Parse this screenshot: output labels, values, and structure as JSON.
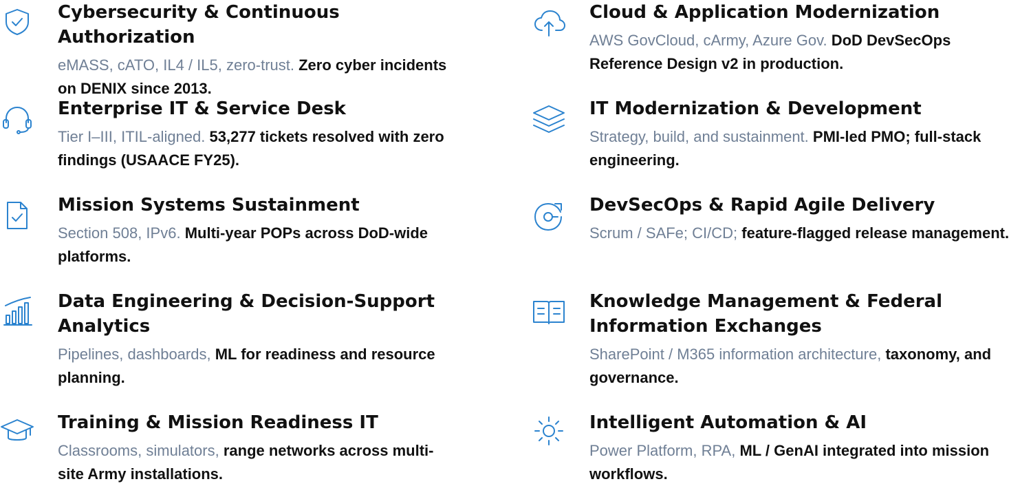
{
  "capabilities": {
    "left": [
      {
        "icon": "shield-check-icon",
        "title": "Cybersecurity & Continuous Authorization",
        "lead": "eMASS, cATO, IL4 / IL5, zero-trust.",
        "detail": "Zero cyber incidents on DENIX since 2013."
      },
      {
        "icon": "headset-icon",
        "title": "Enterprise IT & Service Desk",
        "lead": "Tier I–III, ITIL-aligned.",
        "detail": "53,277 tickets resolved with zero findings (USAACE FY25)."
      },
      {
        "icon": "document-check-icon",
        "title": "Mission Systems Sustainment",
        "lead": "Section 508, IPv6.",
        "detail": "Multi-year POPs across DoD-wide platforms."
      },
      {
        "icon": "bar-chart-icon",
        "title": "Data Engineering & Decision-Support Analytics",
        "lead": "Pipelines, dashboards,",
        "detail": "ML for readiness and resource planning."
      },
      {
        "icon": "graduation-cap-icon",
        "title": "Training & Mission Readiness IT",
        "lead": "Classrooms, simulators,",
        "detail": "range networks across multi-site Army installations."
      }
    ],
    "right": [
      {
        "icon": "cloud-upload-icon",
        "title": "Cloud & Application Modernization",
        "lead": "AWS GovCloud, cArmy, Azure Gov.",
        "detail": "DoD DevSecOps Reference Design v2 in production."
      },
      {
        "icon": "layers-icon",
        "title": "IT Modernization & Development",
        "lead": "Strategy, build, and sustainment.",
        "detail": "PMI-led PMO; full-stack engineering."
      },
      {
        "icon": "refresh-cycle-icon",
        "title": "DevSecOps & Rapid Agile Delivery",
        "lead": "Scrum / SAFe; CI/CD;",
        "detail": "feature-flagged release management."
      },
      {
        "icon": "open-book-icon",
        "title": "Knowledge Management & Federal Information Exchanges",
        "lead": "SharePoint / M365 information architecture,",
        "detail": "taxonomy, and governance."
      },
      {
        "icon": "sun-spark-icon",
        "title": "Intelligent Automation & AI",
        "lead": "Power Platform, RPA,",
        "detail": "ML / GenAI integrated into mission workflows."
      }
    ]
  },
  "colors": {
    "icon_accent": "#2b83cf",
    "lead_text": "#6f7f95",
    "strong_text": "#111111"
  }
}
